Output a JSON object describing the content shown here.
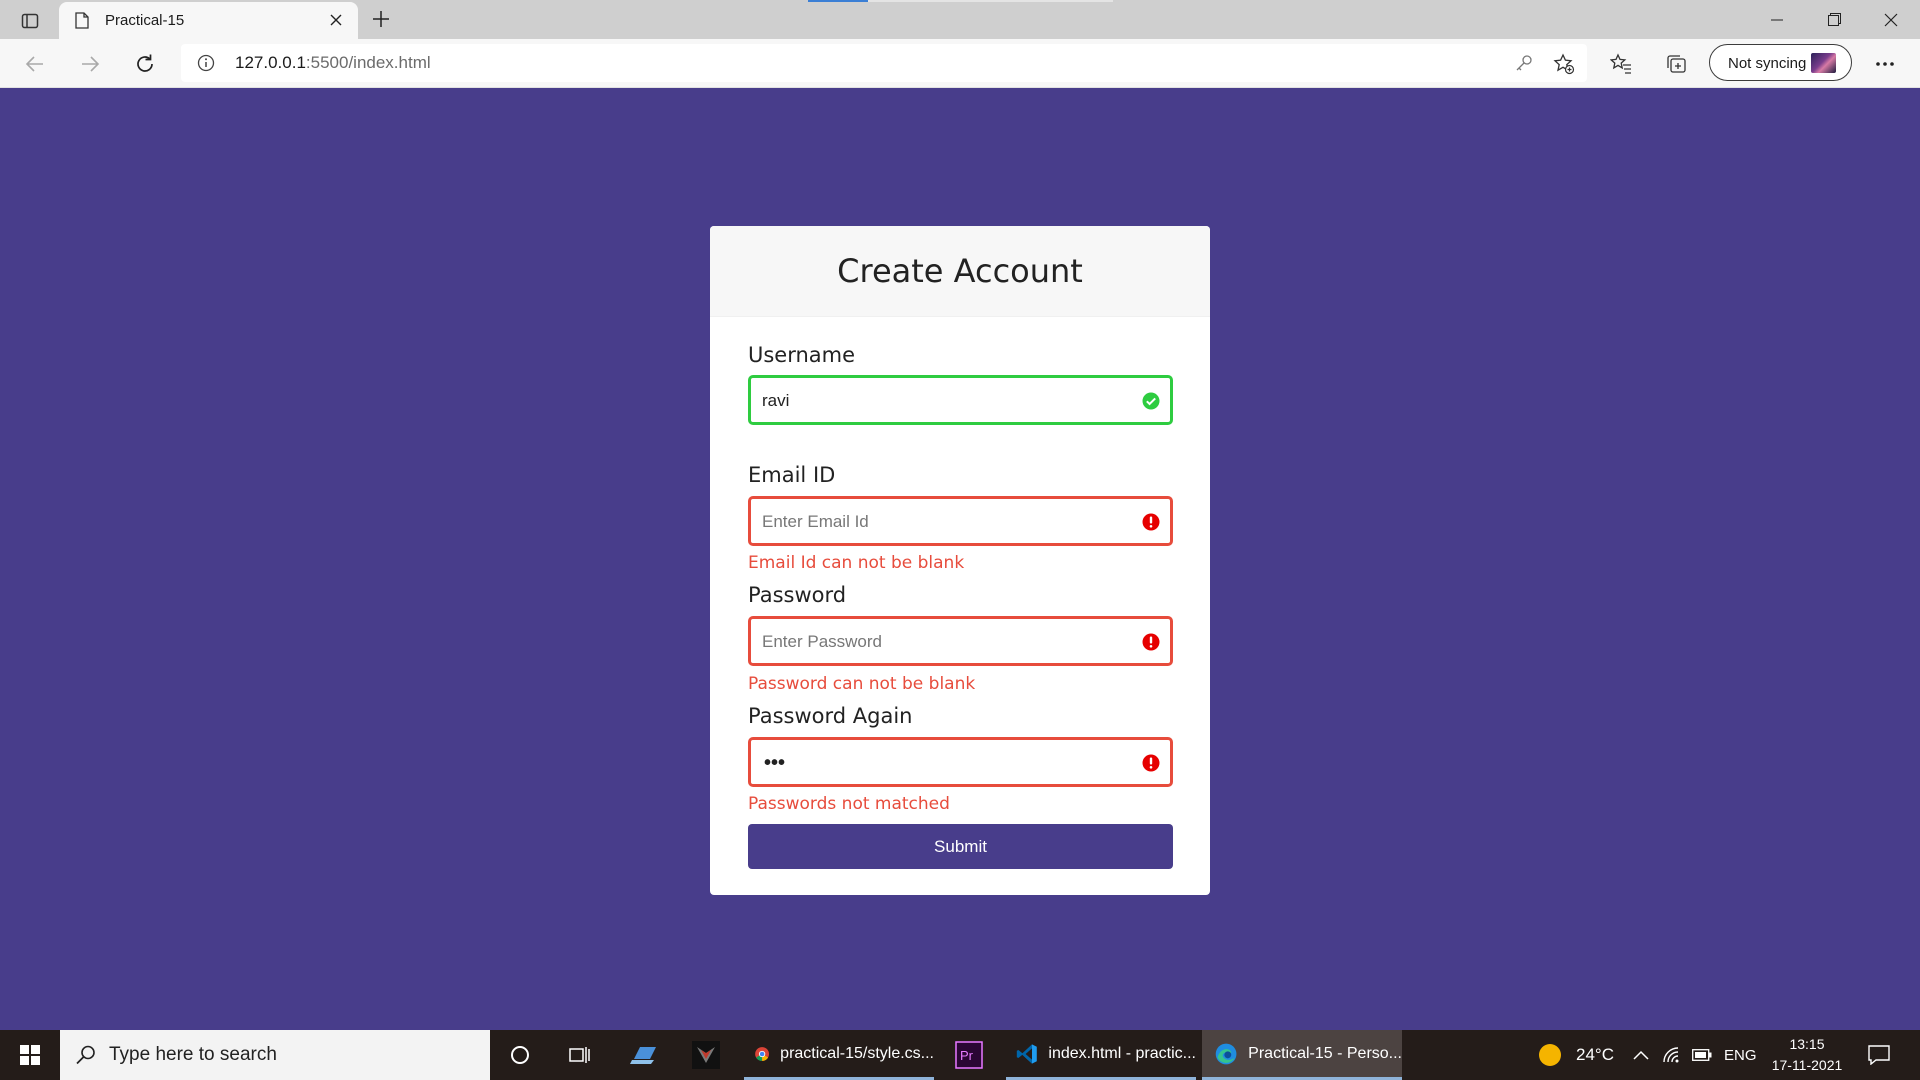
{
  "browser": {
    "tab_title": "Practical-15",
    "url_host": "127.0.0.1",
    "url_rest": ":5500/index.html",
    "sync_label": "Not syncing"
  },
  "form": {
    "title": "Create Account",
    "username": {
      "label": "Username",
      "value": "ravi",
      "state": "success"
    },
    "email": {
      "label": "Email ID",
      "placeholder": "Enter Email Id",
      "error": "Email Id can not be blank",
      "state": "error"
    },
    "password": {
      "label": "Password",
      "placeholder": "Enter Password",
      "error": "Password can not be blank",
      "state": "error"
    },
    "password_again": {
      "label": "Password Again",
      "masked_value": "•••",
      "error": "Passwords not matched",
      "state": "error"
    },
    "submit_label": "Submit"
  },
  "taskbar": {
    "search_placeholder": "Type here to search",
    "apps": [
      {
        "label": "practical-15/style.cs...",
        "icon": "chrome-icon"
      },
      {
        "label": "index.html - practic...",
        "icon": "vscode-icon"
      },
      {
        "label": "Practical-15 - Perso...",
        "icon": "edge-icon",
        "active": true
      }
    ],
    "weather": "24°C",
    "language": "ENG",
    "time": "13:15",
    "date": "17-11-2021"
  },
  "colors": {
    "page_background": "#483d8b",
    "success": "#2ecc40",
    "error": "#e74c3c",
    "button": "#483d8b"
  }
}
